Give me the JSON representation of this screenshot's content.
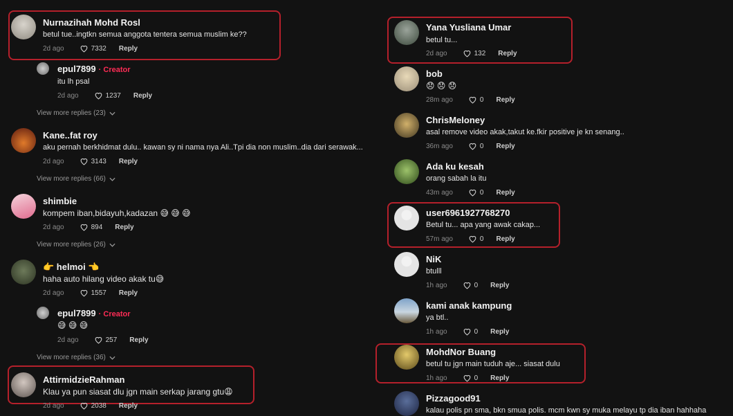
{
  "reply_label": "Reply",
  "left": [
    {
      "name": "Nurnazihah Mohd Rosl",
      "text": "betul tue..ingtkn semua anggota tentera semua muslim ke??",
      "time": "2d ago",
      "likes": "7332"
    },
    {
      "name": "epul7899",
      "creator": "· Creator",
      "text": "itu lh psal",
      "time": "2d ago",
      "likes": "1237"
    },
    {
      "more": "View more replies (23)"
    },
    {
      "name": "Kane..fat roy",
      "text": "aku pernah berkhidmat dulu.. kawan sy ni nama nya Ali..Tpi dia non muslim..dia dari serawak...",
      "time": "2d ago",
      "likes": "3143"
    },
    {
      "more": "View more replies (66)"
    },
    {
      "name": "shimbie",
      "text": "kompem iban,bidayuh,kadazan 😅 😅 😅",
      "time": "2d ago",
      "likes": "894"
    },
    {
      "more": "View more replies (26)"
    },
    {
      "name": "👉 helmoi 👈",
      "text": "haha auto hilang video akak tu😅",
      "time": "2d ago",
      "likes": "1557"
    },
    {
      "name": "epul7899",
      "creator": "· Creator",
      "text": "😅 😅 😅",
      "time": "2d ago",
      "likes": "257"
    },
    {
      "more": "View more replies (36)"
    },
    {
      "name": "AttirmidzieRahman",
      "text": "Klau ya pun siasat dlu jgn main serkap jarang gtu😩",
      "time": "2d ago",
      "likes": "2038"
    }
  ],
  "right": [
    {
      "name": "Yana Yusliana Umar",
      "text": "betul tu...",
      "time": "2d ago",
      "likes": "132"
    },
    {
      "name": "bob",
      "text": "😞 😞 😞",
      "time": "28m ago",
      "likes": "0"
    },
    {
      "name": "ChrisMeloney",
      "text": "asal remove video akak,takut ke.fkir positive je kn senang..",
      "time": "36m ago",
      "likes": "0"
    },
    {
      "name": "Ada ku kesah",
      "text": "orang sabah la itu",
      "time": "43m ago",
      "likes": "0"
    },
    {
      "name": "user6961927768270",
      "text": "Betul tu... apa yang awak cakap...",
      "time": "57m ago",
      "likes": "0"
    },
    {
      "name": "NiK",
      "text": "btulll",
      "time": "1h ago",
      "likes": "0"
    },
    {
      "name": "kami anak kampung",
      "text": "ya btl..",
      "time": "1h ago",
      "likes": "0"
    },
    {
      "name": "MohdNor Buang",
      "text": "betul tu jgn main tuduh aje... siasat dulu",
      "time": "1h ago",
      "likes": "0"
    },
    {
      "name": "Pizzagood91",
      "text": "kalau polis pn sma, bkn smua polis. mcm kwn sy muka melayu tp dia iban hahhaha"
    }
  ],
  "colors": {
    "highlight": "#b5202b",
    "creator": "#fe2c55",
    "background": "#121212"
  }
}
